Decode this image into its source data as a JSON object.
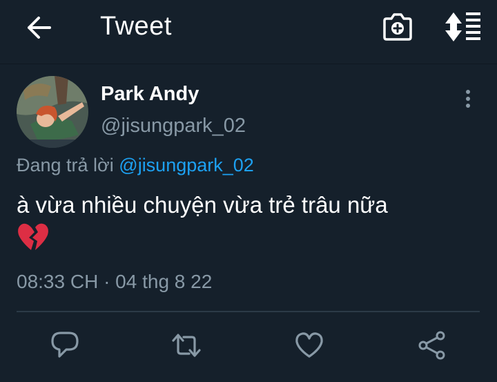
{
  "header": {
    "title": "Tweet",
    "icons": {
      "back": "arrow-left-icon",
      "camera": "camera-add-icon",
      "sort": "sort-lines-icon"
    }
  },
  "tweet": {
    "author": {
      "display_name": "Park Andy",
      "handle": "@jisungpark_02",
      "avatar": "avatar-image"
    },
    "reply_prefix": "Đang trả lời",
    "reply_to": "@jisungpark_02",
    "text": "à vừa nhiều chuyện vừa trẻ trâu nữa",
    "emoji": "broken-heart-emoji",
    "timestamp": "08:33 CH · 04 thg 8 22",
    "actions": [
      "reply-icon",
      "retweet-icon",
      "like-icon",
      "share-icon"
    ]
  },
  "colors": {
    "background": "#15202b",
    "text": "#ffffff",
    "secondary": "#8899a6",
    "link": "#1da1f2",
    "divider": "#2c3a47"
  }
}
